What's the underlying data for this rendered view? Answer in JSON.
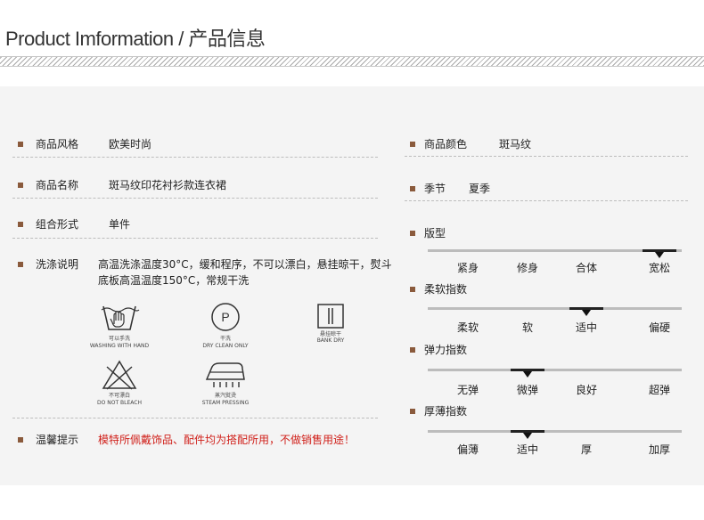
{
  "header": {
    "title": "Product Imformation / 产品信息"
  },
  "left": {
    "style": {
      "label": "商品风格",
      "value": "欧美时尚"
    },
    "name": {
      "label": "商品名称",
      "value": "斑马纹印花衬衫款连衣裙"
    },
    "combo": {
      "label": "组合形式",
      "value": "单件"
    },
    "wash": {
      "label": "洗涤说明",
      "value": "高温洗涤温度30°C，缓和程序，不可以漂白，悬挂晾干，熨斗底板高温温度150°C，常规干洗",
      "icons": [
        {
          "icon": "hand-wash-icon",
          "cn": "可以手洗",
          "en": "WASHING WITH HAND"
        },
        {
          "icon": "dry-clean-icon",
          "cn": "干洗",
          "en": "DRY CLEAN ONLY"
        },
        {
          "icon": "hang-dry-icon",
          "cn": "悬挂晾干",
          "en": "BANK DRY"
        },
        {
          "icon": "no-bleach-icon",
          "cn": "不可漂白",
          "en": "DO NOT BLEACH"
        },
        {
          "icon": "steam-iron-icon",
          "cn": "蒸汽熨烫",
          "en": "STEAM PRESSING"
        }
      ]
    },
    "notice": {
      "label": "温馨提示",
      "value": "模特所佩戴饰品、配件均为搭配所用，不做销售用途！"
    }
  },
  "right": {
    "color": {
      "label": "商品颜色",
      "value": "斑马纹"
    },
    "season": {
      "label": "季节",
      "value": "夏季"
    },
    "scales": [
      {
        "label": "版型",
        "options": [
          "紧身",
          "修身",
          "合体",
          "宽松"
        ],
        "selected": 3
      },
      {
        "label": "柔软指数",
        "options": [
          "柔软",
          "软",
          "适中",
          "偏硬"
        ],
        "selected": 2
      },
      {
        "label": "弹力指数",
        "options": [
          "无弹",
          "微弹",
          "良好",
          "超弹"
        ],
        "selected": 1
      },
      {
        "label": "厚薄指数",
        "options": [
          "偏薄",
          "适中",
          "厚",
          "加厚"
        ],
        "selected": 1
      }
    ]
  },
  "colors": {
    "accent": "#8a5a3c",
    "notice": "#d0201a",
    "marker": "#222222"
  }
}
